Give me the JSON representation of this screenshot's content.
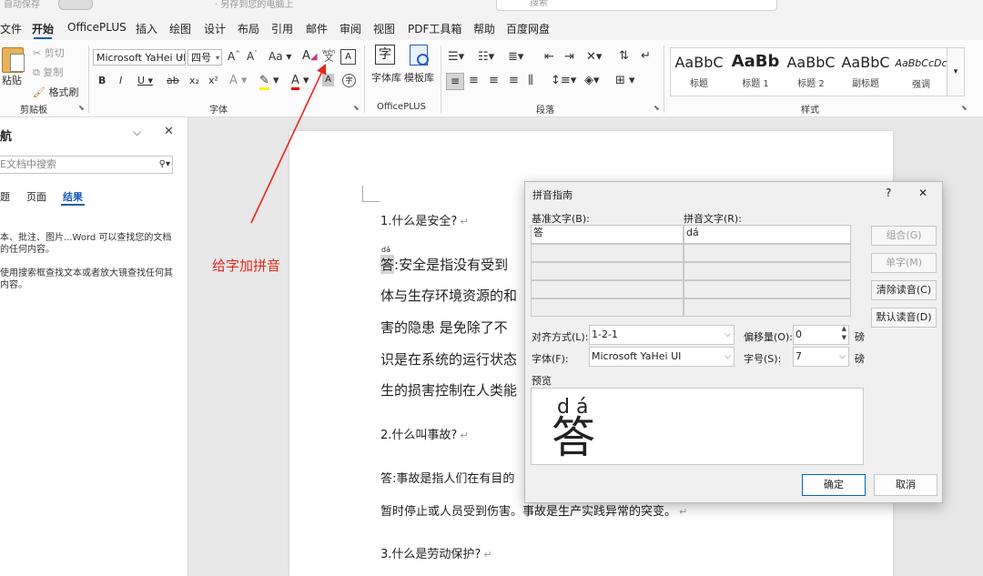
{
  "title_bar": {
    "autosave": "自动保存",
    "doc_title": "· 另存到您的电脑上",
    "search_placeholder": "搜索"
  },
  "tabs": [
    "文件",
    "开始",
    "OfficePLUS",
    "插入",
    "绘图",
    "设计",
    "布局",
    "引用",
    "邮件",
    "审阅",
    "视图",
    "PDF工具箱",
    "帮助",
    "百度网盘"
  ],
  "active_tab": "开始",
  "ribbon": {
    "clipboard": {
      "paste": "粘贴",
      "cut": "剪切",
      "copy": "复制",
      "format_painter": "格式刷",
      "label": "剪贴板"
    },
    "font": {
      "font_name": "Microsoft YaHei UI",
      "font_size": "四号",
      "grow": "A^",
      "shrink": "Aˇ",
      "case": "Aa",
      "bold": "B",
      "italic": "I",
      "underline": "U",
      "strike": "ab",
      "subscript": "x₂",
      "superscript": "x²",
      "phonetic_icon_text": "wén",
      "label": "字体"
    },
    "officeplus": {
      "font_library": "字体库",
      "template_library": "模板库",
      "label": "OfficePLUS"
    },
    "paragraph": {
      "label": "段落"
    },
    "styles": {
      "items": [
        {
          "preview": "AaBbC",
          "name": "标题"
        },
        {
          "preview": "AaBb",
          "name": "标题 1"
        },
        {
          "preview": "AaBbC",
          "name": "标题 2"
        },
        {
          "preview": "AaBbC",
          "name": "副标题"
        },
        {
          "preview": "AaBbCcDc",
          "name": "强调"
        }
      ],
      "label": "样式"
    }
  },
  "nav_pane": {
    "title": "航",
    "search_placeholder": "E文档中搜索",
    "tabs": [
      "题",
      "页面",
      "结果"
    ],
    "active_tab": "结果",
    "message1_line1": "本、批注、图片...Word 可以查找您的文档",
    "message1_line2": "的任何内容。",
    "message2_line1": "使用搜索框查找文本或者放大镜查找任何其",
    "message2_line2": "内容。"
  },
  "annotation": {
    "text": "给字加拼音",
    "color": "#e8261c"
  },
  "document": {
    "q1": "1.什么是安全?",
    "answer_char": "答",
    "answer_ruby": "dá",
    "a1_line1": ":安全是指没有受到",
    "a1_line2": "体与生存环境资源的和",
    "a1_line3": "害的隐患  是免除了不",
    "a1_line4": "识是在系统的运行状态",
    "a1_line5": "生的损害控制在人类能",
    "q2": "2.什么叫事故?",
    "a2_line1": "答:事故是指人们在有目的",
    "a2_line2": "暂时停止或人员受到伤害。事故是生产实践异常的突变。",
    "q3": "3.什么是劳动保护?",
    "paragraph_mark": "↵"
  },
  "dialog": {
    "title": "拼音指南",
    "help": "?",
    "close": "✕",
    "base_text_label": "基准文字(B):",
    "ruby_text_label": "拼音文字(R):",
    "base_text_value": "答",
    "ruby_text_value": "dá",
    "buttons": {
      "group": "组合(G)",
      "mono": "单字(M)",
      "clear": "清除读音(C)",
      "default": "默认读音(D)"
    },
    "alignment_label": "对齐方式(L):",
    "alignment_value": "1-2-1",
    "offset_label": "偏移量(O):",
    "offset_value": "0",
    "offset_unit": "磅",
    "font_label": "字体(F):",
    "font_value": "Microsoft YaHei UI",
    "size_label": "字号(S):",
    "size_value": "7",
    "size_unit": "磅",
    "preview_label": "预览",
    "preview_ruby": "d á",
    "preview_char": "答",
    "ok": "确定",
    "cancel": "取消"
  },
  "colors": {
    "accent": "#185abd",
    "annotation": "#e8261c",
    "ok_border": "#0067c0"
  }
}
